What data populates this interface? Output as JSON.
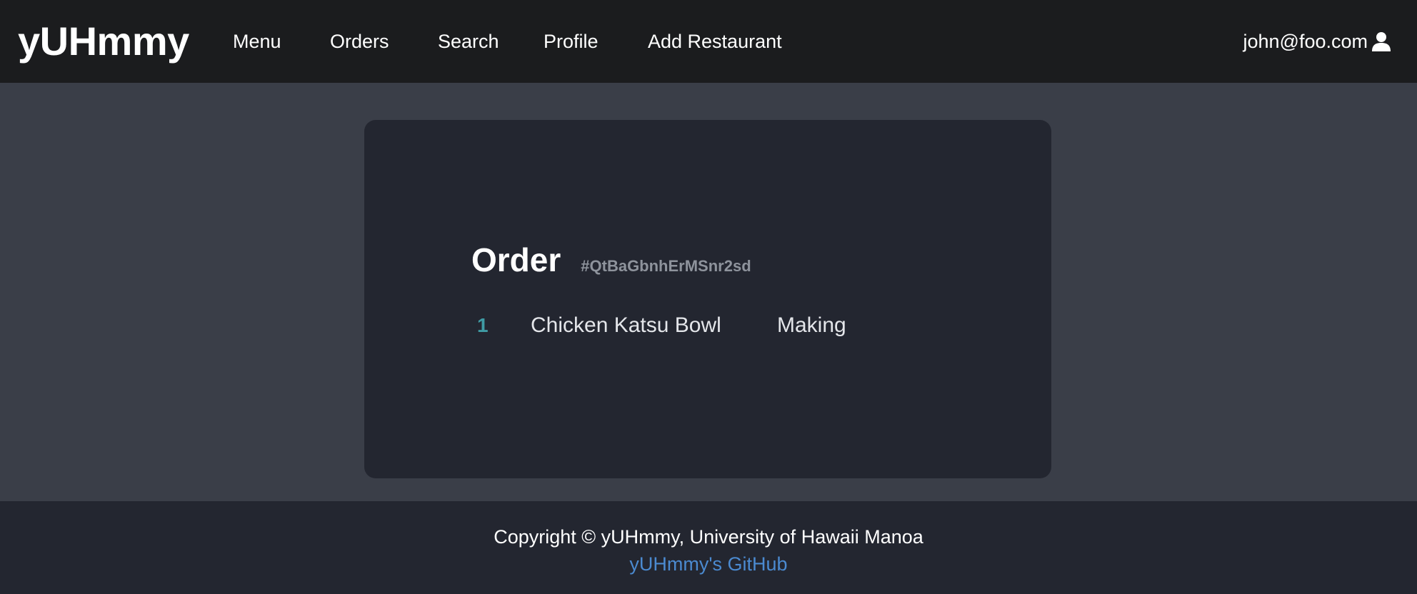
{
  "header": {
    "brand": "yUHmmy",
    "nav": {
      "menu": "Menu",
      "orders": "Orders",
      "search": "Search",
      "profile": "Profile",
      "add_restaurant": "Add Restaurant"
    },
    "user_email": "john@foo.com",
    "user_icon": "user-icon"
  },
  "order": {
    "title": "Order",
    "id": "#QtBaGbnhErMSnr2sd",
    "items": [
      {
        "quantity": "1",
        "name": "Chicken Katsu Bowl",
        "status": "Making"
      }
    ]
  },
  "footer": {
    "copyright": "Copyright © yUHmmy, University of Hawaii Manoa",
    "github_link": "yUHmmy's GitHub"
  },
  "colors": {
    "header_bg": "#1b1c1e",
    "page_bg": "#3a3e48",
    "card_bg": "#232630",
    "footer_bg": "#232630",
    "quantity_accent": "#3f9ba4",
    "link": "#4b8ad0",
    "muted_text": "#8e939c"
  }
}
